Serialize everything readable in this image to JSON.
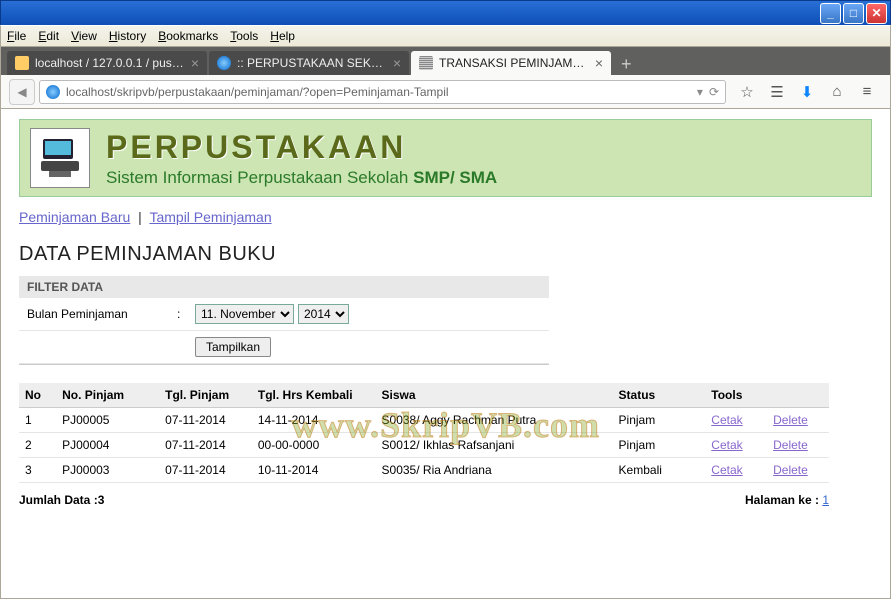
{
  "window": {
    "menus": [
      "File",
      "Edit",
      "View",
      "History",
      "Bookmarks",
      "Tools",
      "Help"
    ]
  },
  "tabs": [
    {
      "label": "localhost / 127.0.0.1 / pustak...",
      "active": false,
      "favicon": "pma"
    },
    {
      "label": ":: PERPUSTAKAAN SEKOLAH - Sist...",
      "active": false,
      "favicon": "globe"
    },
    {
      "label": "TRANSAKSI PEMINJAMAN",
      "active": true,
      "favicon": "dash"
    }
  ],
  "url": "localhost/skripvb/perpustakaan/peminjaman/?open=Peminjaman-Tampil",
  "app": {
    "title": "PERPUSTAKAAN",
    "subtitle_a": "Sistem Informasi Perpustakaan Sekolah ",
    "subtitle_b": "SMP/ SMA"
  },
  "actions": {
    "new": "Peminjaman Baru",
    "show": "Tampil Peminjaman"
  },
  "section_title": "DATA PEMINJAMAN BUKU",
  "filter": {
    "header": "FILTER DATA",
    "label": "Bulan Peminjaman",
    "month": "11. November",
    "year": "2014",
    "button": "Tampilkan"
  },
  "columns": [
    "No",
    "No. Pinjam",
    "Tgl. Pinjam",
    "Tgl. Hrs Kembali",
    "Siswa",
    "Status",
    "Tools",
    ""
  ],
  "rows": [
    {
      "no": "1",
      "nop": "PJ00005",
      "tgl": "07-11-2014",
      "hrs": "14-11-2014",
      "siswa": "S0038/ Aggy Rachman Putra",
      "status": "Pinjam"
    },
    {
      "no": "2",
      "nop": "PJ00004",
      "tgl": "07-11-2014",
      "hrs": "00-00-0000",
      "siswa": "S0012/ Ikhlas Rafsanjani",
      "status": "Pinjam"
    },
    {
      "no": "3",
      "nop": "PJ00003",
      "tgl": "07-11-2014",
      "hrs": "10-11-2014",
      "siswa": "S0035/ Ria Andriana",
      "status": "Kembali"
    }
  ],
  "tools": {
    "print": "Cetak",
    "delete": "Delete"
  },
  "footer": {
    "count_label": "Jumlah Data :",
    "count": "3",
    "page_label": "Halaman ke : ",
    "page": "1"
  },
  "watermark": "www.SkripVB.com"
}
